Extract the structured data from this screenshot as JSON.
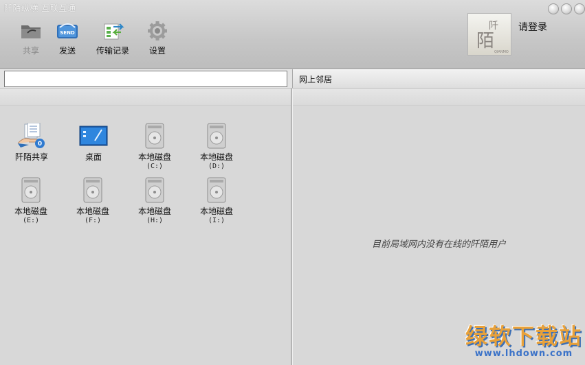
{
  "app": {
    "title": "阡陌纵横 互联互通",
    "login_label": "请登录"
  },
  "toolbar": [
    {
      "label": "共享",
      "icon": "folder-share-icon",
      "disabled": true
    },
    {
      "label": "发送",
      "icon": "send-icon",
      "disabled": false
    },
    {
      "label": "传输记录",
      "icon": "transfer-log-icon",
      "disabled": false
    },
    {
      "label": "设置",
      "icon": "gear-icon",
      "disabled": false
    }
  ],
  "avatar": {
    "glyphs": "阡陌",
    "caption": "QIANMO"
  },
  "address_bar": {
    "value": "",
    "placeholder": ""
  },
  "right_panel": {
    "header": "网上邻居",
    "empty_message": "目前局域网内没有在线的阡陌用户"
  },
  "files": [
    {
      "name": "阡陌共享",
      "sub": "",
      "icon": "shared-docs-icon",
      "badge": "0"
    },
    {
      "name": "桌面",
      "sub": "",
      "icon": "desktop-icon"
    },
    {
      "name": "本地磁盘",
      "sub": "(C:)",
      "icon": "disk-icon"
    },
    {
      "name": "本地磁盘",
      "sub": "(D:)",
      "icon": "disk-icon"
    },
    {
      "name": "本地磁盘",
      "sub": "(E:)",
      "icon": "disk-icon"
    },
    {
      "name": "本地磁盘",
      "sub": "(F:)",
      "icon": "disk-icon"
    },
    {
      "name": "本地磁盘",
      "sub": "(H:)",
      "icon": "disk-icon"
    },
    {
      "name": "本地磁盘",
      "sub": "(I:)",
      "icon": "disk-icon"
    }
  ],
  "watermark": {
    "text": "绿软下载站",
    "url": "www.lhdown.com"
  },
  "colors": {
    "toolbar_bg": "#c8c8c8",
    "pane_bg": "#d8d8d8",
    "watermark_orange": "#e8a13a",
    "watermark_blue": "#3a72c8"
  }
}
